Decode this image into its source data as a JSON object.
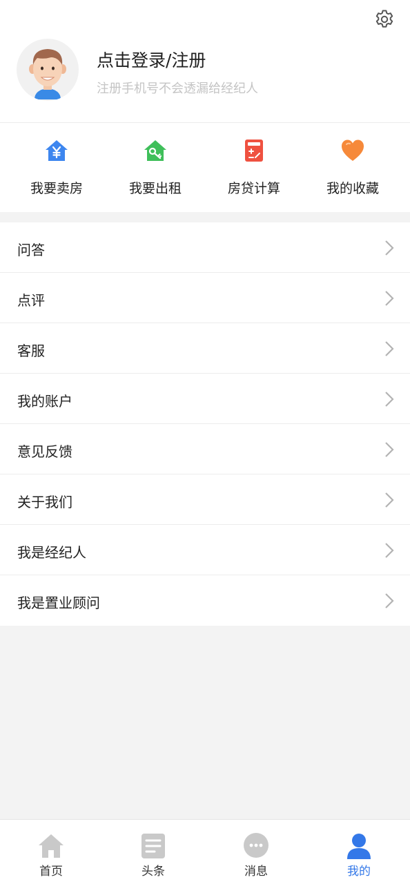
{
  "header": {
    "settings_icon": "gear-icon",
    "avatar_icon": "avatar-cartoon-man",
    "login_title": "点击登录/注册",
    "login_subtitle": "注册手机号不会透漏给经纪人"
  },
  "quick_actions": [
    {
      "label": "我要卖房",
      "icon": "house-yen-icon",
      "color": "#3d86ef"
    },
    {
      "label": "我要出租",
      "icon": "house-key-icon",
      "color": "#3fbf5a"
    },
    {
      "label": "房贷计算",
      "icon": "calculator-icon",
      "color": "#ef5140"
    },
    {
      "label": "我的收藏",
      "icon": "heart-icon",
      "color": "#f6893a"
    }
  ],
  "menu": [
    {
      "label": "问答"
    },
    {
      "label": "点评"
    },
    {
      "label": "客服"
    },
    {
      "label": "我的账户"
    },
    {
      "label": "意见反馈"
    },
    {
      "label": "关于我们"
    },
    {
      "label": "我是经纪人"
    },
    {
      "label": "我是置业顾问"
    }
  ],
  "tabbar": {
    "active_color": "#3478e8",
    "inactive_color": "#c9c9c9",
    "tabs": [
      {
        "label": "首页",
        "icon": "home-icon",
        "active": false
      },
      {
        "label": "头条",
        "icon": "news-icon",
        "active": false
      },
      {
        "label": "消息",
        "icon": "chat-bubble-icon",
        "active": false
      },
      {
        "label": "我的",
        "icon": "user-icon",
        "active": true
      }
    ]
  }
}
